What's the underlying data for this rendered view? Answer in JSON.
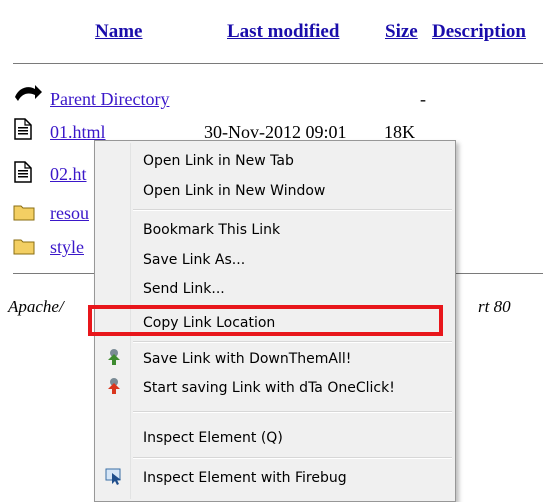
{
  "listing": {
    "headers": {
      "name": "Name",
      "last_modified": "Last modified",
      "size": "Size",
      "description": "Description"
    },
    "parent": {
      "label": "Parent Directory",
      "size": "-"
    },
    "rows": [
      {
        "name": "01.html",
        "modified": "30-Nov-2012 09:01",
        "size": "18K"
      },
      {
        "name": "02.ht"
      },
      {
        "name": "resou"
      },
      {
        "name": "style"
      }
    ],
    "footer_left": "Apache/",
    "footer_right": "rt 80"
  },
  "context_menu": {
    "items": [
      {
        "label": "Open Link in New Tab"
      },
      {
        "label": "Open Link in New Window"
      },
      {
        "label": "Bookmark This Link"
      },
      {
        "label": "Save Link As..."
      },
      {
        "label": "Send Link..."
      },
      {
        "label": "Copy Link Location",
        "highlighted": true
      },
      {
        "label": "Save Link with DownThemAll!",
        "icon": "downthemall-icon"
      },
      {
        "label": "Start saving Link with dTa OneClick!",
        "icon": "dta-oneclick-icon"
      },
      {
        "label": "Inspect Element (Q)"
      },
      {
        "label": "Inspect Element with Firebug",
        "icon": "firebug-inspect-icon"
      }
    ]
  },
  "colors": {
    "link": "#3a17c9",
    "header_link": "#1a0dab",
    "highlight_border": "#e8161b",
    "menu_bg": "#f0f0f0"
  }
}
